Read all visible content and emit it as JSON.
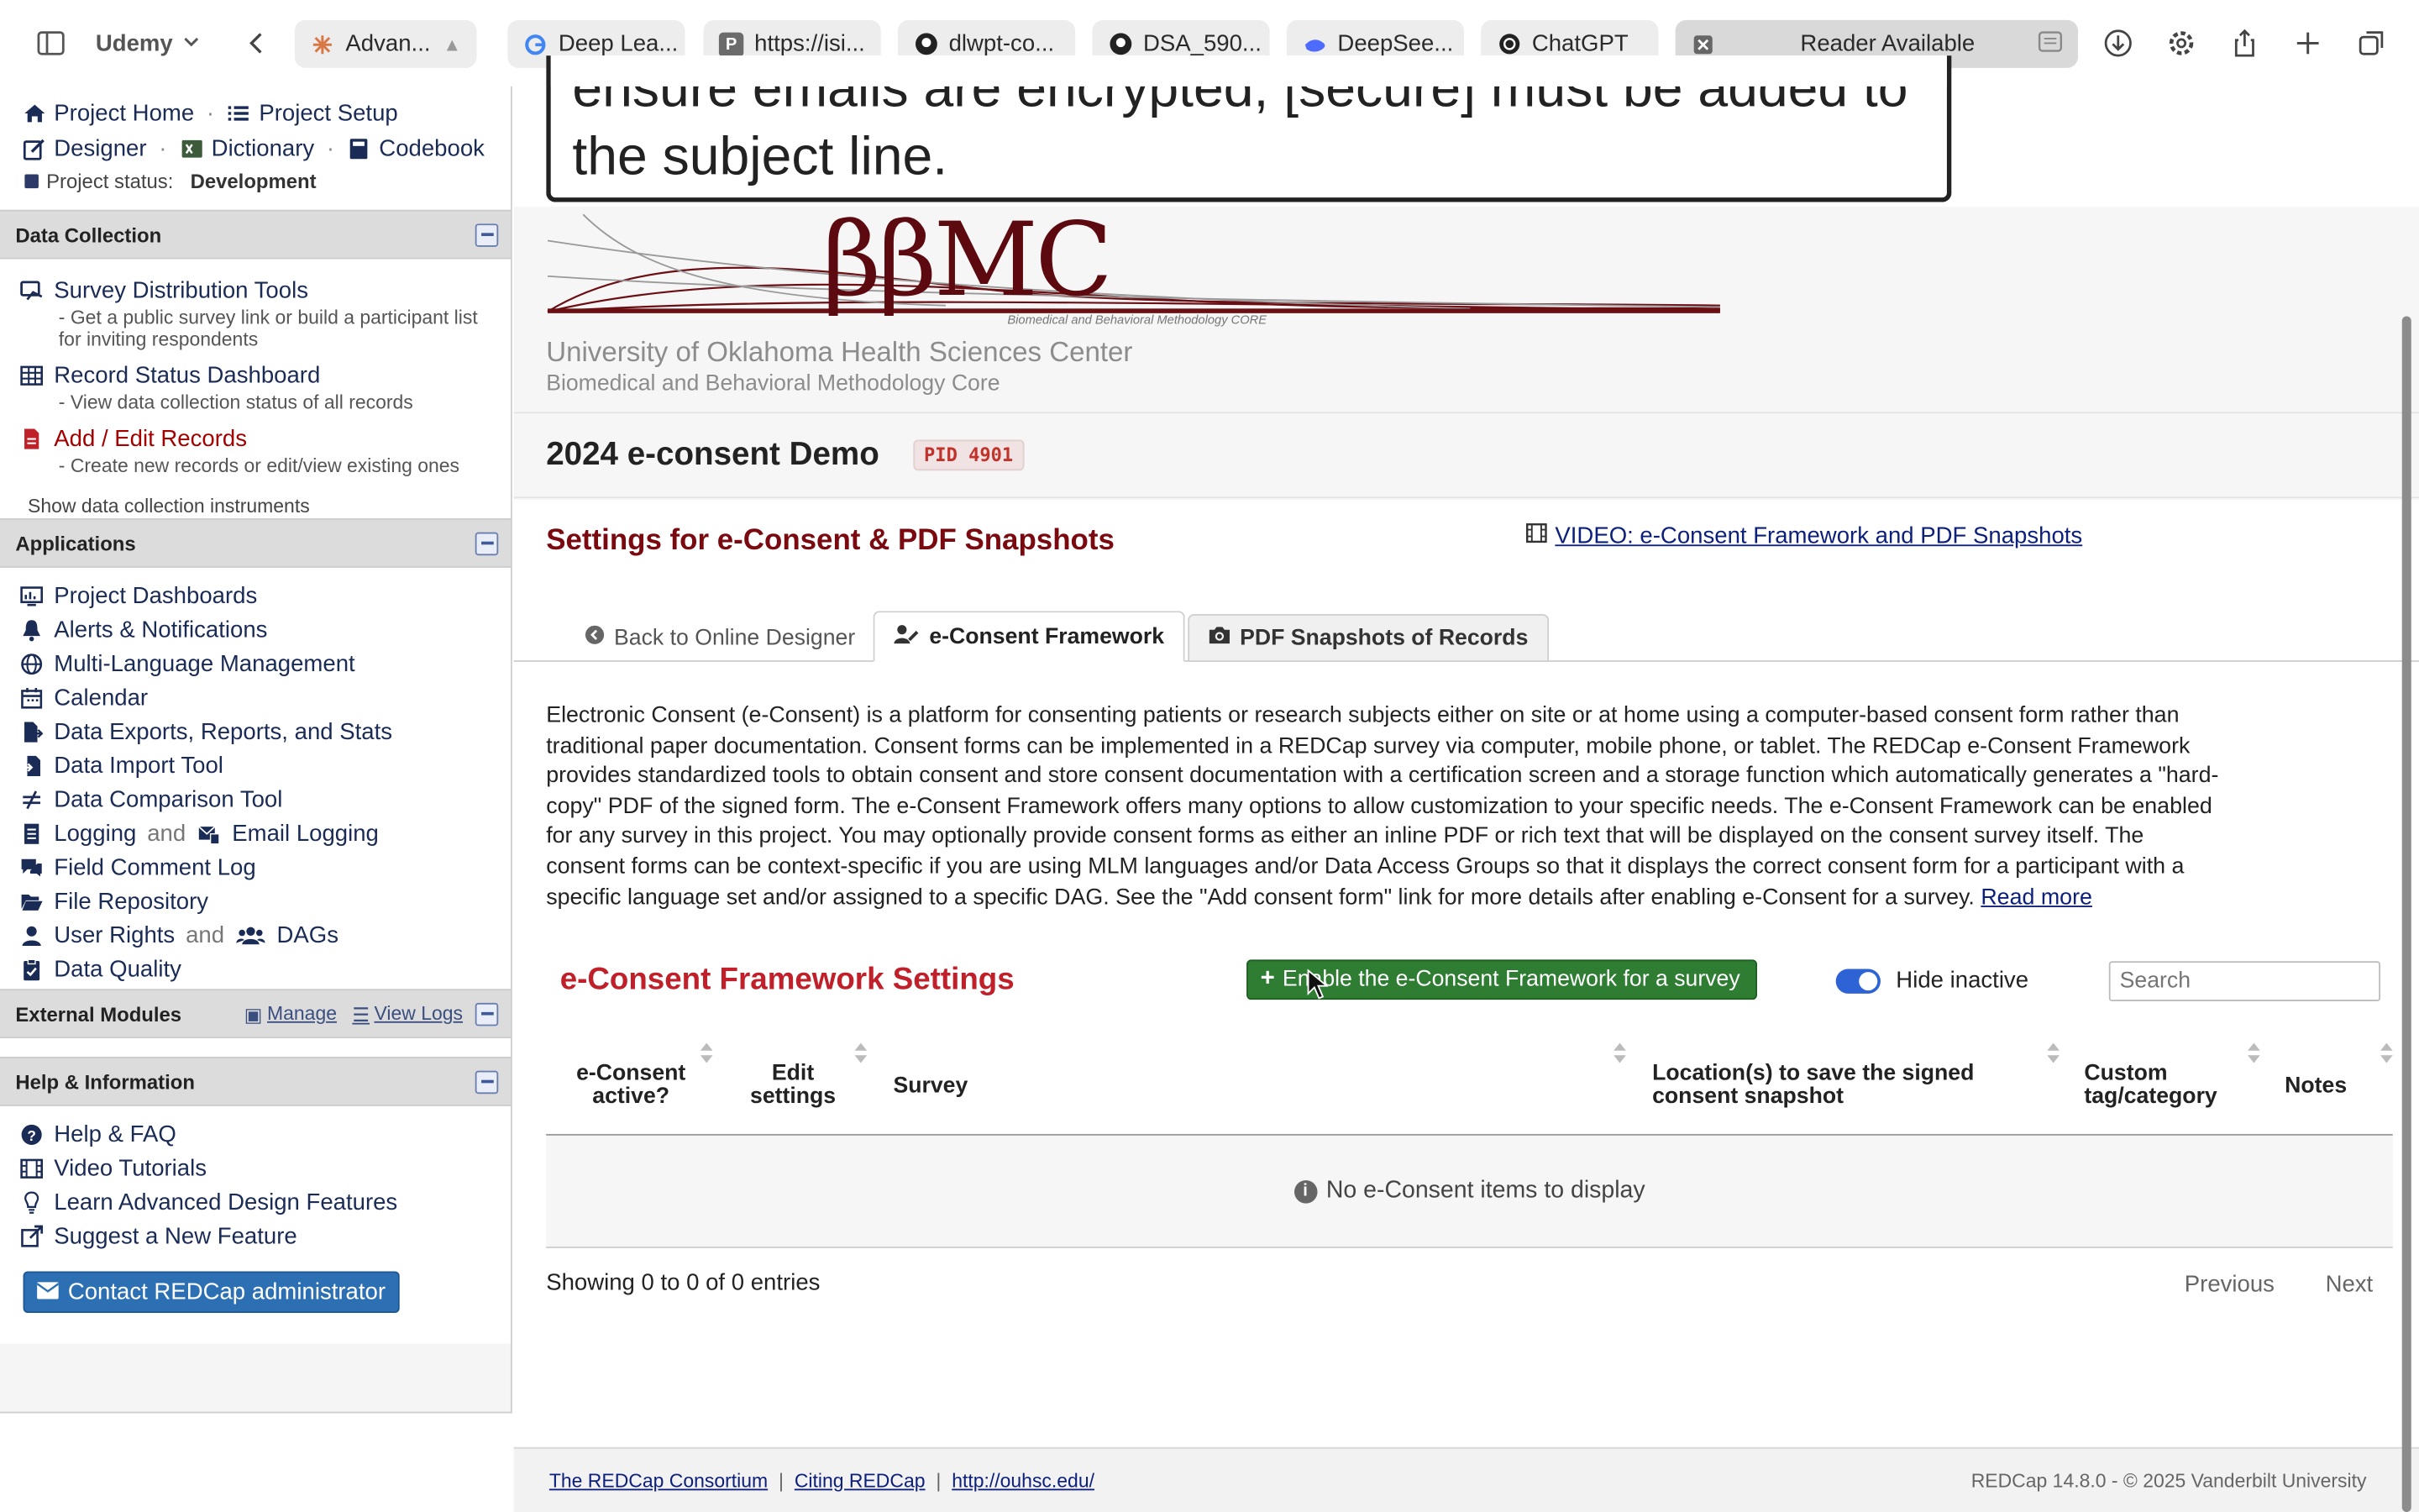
{
  "browser": {
    "profile": "Udemy",
    "tabs": [
      {
        "label": "Advan...",
        "icon": "sparkle-icon"
      },
      {
        "label": "Deep Lea...",
        "icon": "google-icon"
      },
      {
        "label": "https://isi...",
        "icon": "p-icon"
      },
      {
        "label": "dlwpt-co...",
        "icon": "github-icon"
      },
      {
        "label": "DSA_590...",
        "icon": "github-icon"
      },
      {
        "label": "DeepSee...",
        "icon": "whale-icon"
      },
      {
        "label": "ChatGPT",
        "icon": "openai-icon"
      },
      {
        "label": "Reader Available",
        "icon": "close-icon"
      }
    ]
  },
  "sidebar": {
    "project_home": "Project Home",
    "project_setup": "Project Setup",
    "designer": "Designer",
    "dictionary": "Dictionary",
    "codebook": "Codebook",
    "status_label": "Project status:",
    "status_value": "Development",
    "data_collection": {
      "title": "Data Collection",
      "items": [
        {
          "label": "Survey Distribution Tools",
          "desc": "- Get a public survey link or build a participant list for inviting respondents"
        },
        {
          "label": "Record Status Dashboard",
          "desc": "- View data collection status of all records"
        },
        {
          "label": "Add / Edit Records",
          "desc": "- Create new records or edit/view existing ones"
        }
      ],
      "show_instruments": "Show data collection instruments"
    },
    "applications": {
      "title": "Applications",
      "items": [
        "Project Dashboards",
        "Alerts & Notifications",
        "Multi-Language Management",
        "Calendar",
        "Data Exports, Reports, and Stats",
        "Data Import Tool",
        "Data Comparison Tool"
      ],
      "logging": "Logging",
      "and1": "and",
      "email_logging": "Email Logging",
      "field_comment": "Field Comment Log",
      "file_repo": "File Repository",
      "user_rights": "User Rights",
      "and2": "and",
      "dags": "DAGs",
      "data_quality": "Data Quality"
    },
    "external_modules": {
      "title": "External Modules",
      "manage": "Manage",
      "view_logs": "View Logs"
    },
    "help": {
      "title": "Help & Information",
      "items": [
        "Help & FAQ",
        "Video Tutorials",
        "Learn Advanced Design Features",
        "Suggest a New Feature"
      ],
      "contact": "Contact REDCap administrator"
    }
  },
  "main": {
    "alert_text": "ensure emails are encrypted, [secure] must be added to the subject line.",
    "logo": "ββMC",
    "logo_sub": "Biomedical and Behavioral Methodology CORE",
    "institution": "University of Oklahoma Health Sciences Center",
    "core": "Biomedical and Behavioral Methodology Core",
    "project_title": "2024 e-consent Demo",
    "pid": "PID 4901",
    "settings_title": "Settings for e-Consent & PDF Snapshots",
    "video_link": "VIDEO: e-Consent Framework and PDF Snapshots",
    "tabs": {
      "back": "Back to Online Designer",
      "framework": "e-Consent Framework",
      "snapshots": "PDF Snapshots of Records"
    },
    "description": "Electronic Consent (e-Consent) is a platform for consenting patients or research subjects either on site or at home using a computer-based consent form rather than traditional paper documentation. Consent forms can be implemented in a REDCap survey via computer, mobile phone, or tablet. The REDCap e-Consent Framework provides standardized tools to obtain consent and store consent documentation with a certification screen and a storage function which automatically generates a \"hard-copy\" PDF of the signed form. The e-Consent Framework offers many options to allow customization to your specific needs. The e-Consent Framework can be enabled for any survey in this project. You may optionally provide consent forms as either an inline PDF or rich text that will be displayed on the consent survey itself. The consent forms can be context-specific if you are using MLM languages and/or Data Access Groups so that it displays the correct consent form for a participant with a specific language set and/or assigned to a specific DAG. See the \"Add consent form\" link for more details after enabling e-Consent for a survey.",
    "read_more": "Read more",
    "framework_title": "e-Consent Framework Settings",
    "enable_button": "Enable the e-Consent Framework for a survey",
    "hide_inactive": "Hide inactive",
    "hide_inactive_on": true,
    "search_placeholder": "Search",
    "columns": {
      "active": "e-Consent active?",
      "edit": "Edit settings",
      "survey": "Survey",
      "location": "Location(s) to save the signed consent snapshot",
      "custom": "Custom tag/category",
      "notes": "Notes"
    },
    "empty_message": "No e-Consent items to display",
    "showing": "Showing 0 to 0 of 0 entries",
    "previous": "Previous",
    "next": "Next"
  },
  "footer": {
    "consortium": "The REDCap Consortium",
    "citing": "Citing REDCap",
    "url": "http://ouhsc.edu/",
    "version": "REDCap 14.8.0 - © 2025 Vanderbilt University"
  },
  "colors": {
    "brand_red": "#7a0a10",
    "accent_blue": "#2c6fb3",
    "green": "#2e7d32"
  }
}
